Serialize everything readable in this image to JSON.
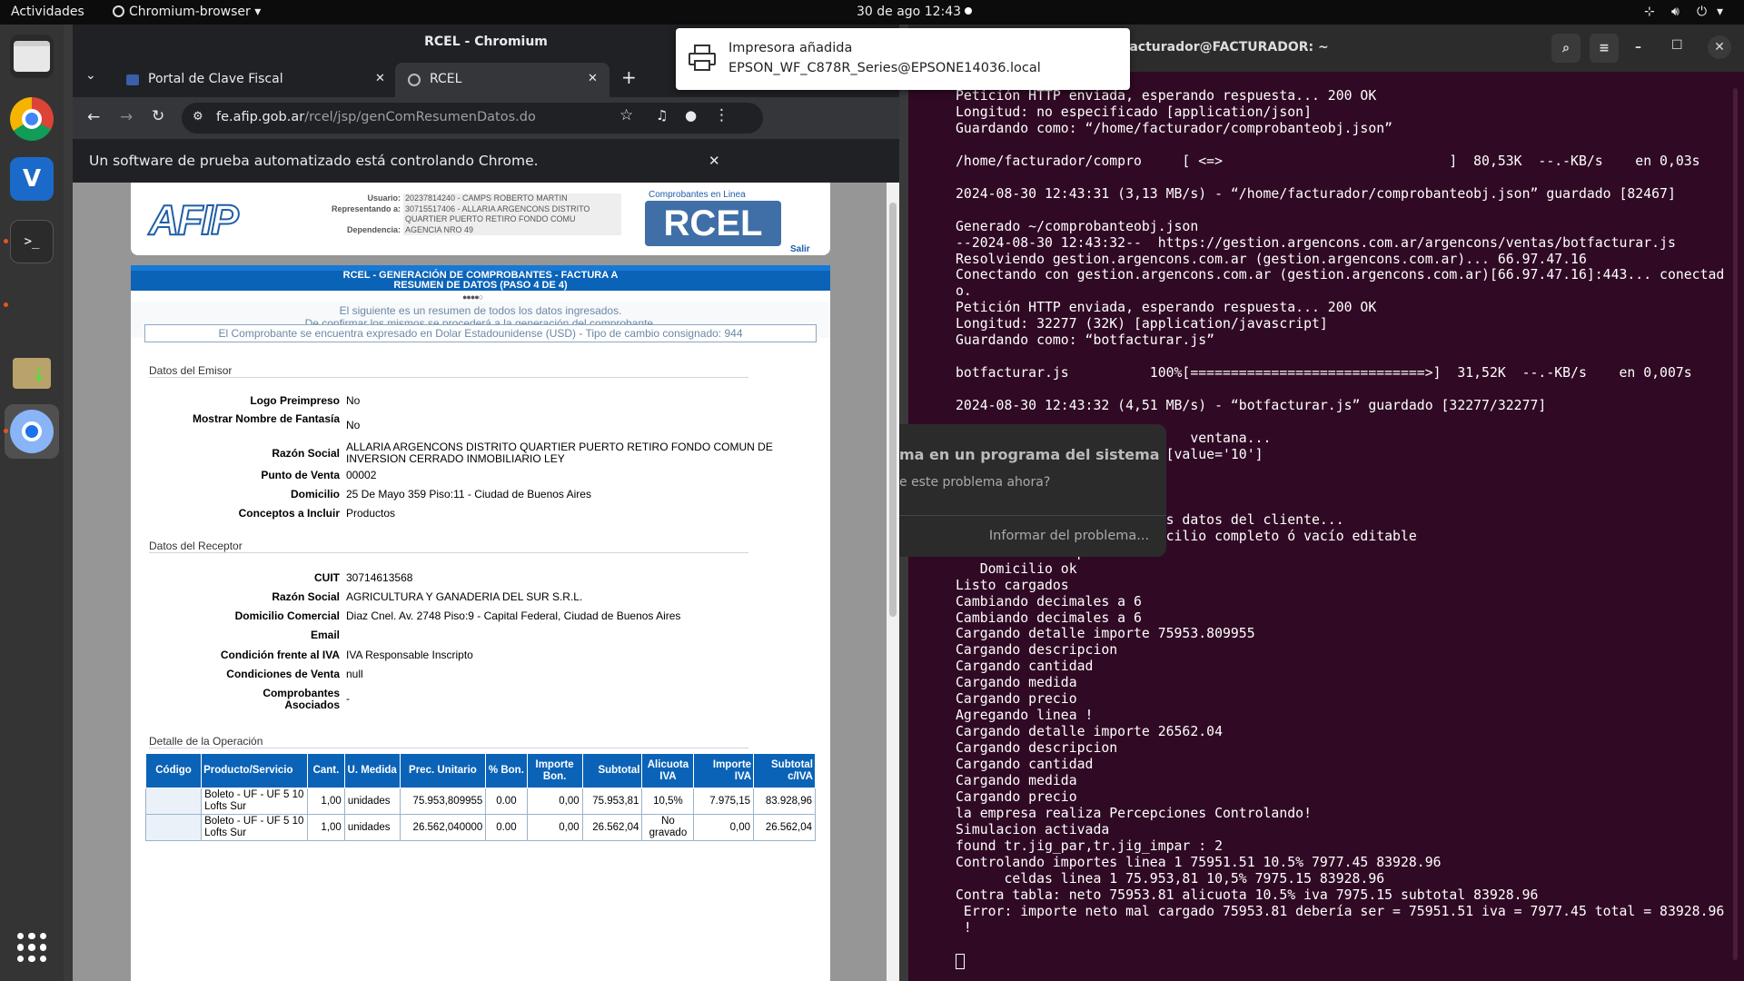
{
  "topbar": {
    "activities": "Actividades",
    "app_menu": "Chromium-browser",
    "clock": "30 de ago  12:43"
  },
  "notification": {
    "title": "Impresora añadida",
    "body": "EPSON_WF_C878R_Series@EPSONE14036.local"
  },
  "chrome": {
    "window_title": "RCEL - Chromium",
    "tabs": [
      {
        "label": "Portal de Clave Fiscal"
      },
      {
        "label": "RCEL"
      }
    ],
    "url_host": "fe.afip.gob.ar",
    "url_path": "/rcel/jsp/genComResumenDatos.do",
    "infobar": "Un software de prueba automatizado está controlando Chrome."
  },
  "afip": {
    "header": {
      "user_label": "Usuario:",
      "user_value": "20237814240 - CAMPS ROBERTO MARTIN",
      "rep_label": "Representando a:",
      "rep_value": "30715517406 - ALLARIA ARGENCONS DISTRITO QUARTIER PUERTO RETIRO FONDO COMU",
      "dep_label": "Dependencia:",
      "dep_value": "AGENCIA NRO 49",
      "rcel_caption": "Comprobantes en Linea",
      "logout": "Salir"
    },
    "banner_line1": "RCEL - GENERACIÓN DE COMPROBANTES - FACTURA A",
    "banner_line2": "RESUMEN DE DATOS (PASO 4 DE 4)",
    "info1": "El siguiente es un resumen de todos los datos ingresados.",
    "info2": "De confirmar los mismos se procederá a la generación del comprobante.",
    "currency_note": "El Comprobante se encuentra expresado en Dolar Estadounidense (USD) - Tipo de cambio consignado: 944",
    "emisor": {
      "title": "Datos del Emisor",
      "rows": [
        {
          "label": "Logo Preimpreso",
          "value": "No"
        },
        {
          "label": "Mostrar Nombre de Fantasía",
          "value": "No"
        },
        {
          "label": "Razón Social",
          "value": "ALLARIA ARGENCONS DISTRITO QUARTIER PUERTO RETIRO FONDO COMUN DE INVERSION CERRADO INMOBILIARIO LEY"
        },
        {
          "label": "Punto de Venta",
          "value": "00002"
        },
        {
          "label": "Domicilio",
          "value": "25 De Mayo 359 Piso:11 - Ciudad de Buenos Aires"
        },
        {
          "label": "Conceptos a Incluir",
          "value": "Productos"
        }
      ]
    },
    "receptor": {
      "title": "Datos del Receptor",
      "rows": [
        {
          "label": "CUIT",
          "value": "30714613568"
        },
        {
          "label": "Razón Social",
          "value": "AGRICULTURA Y GANADERIA DEL SUR S.R.L."
        },
        {
          "label": "Domicilio Comercial",
          "value": "Diaz Cnel. Av. 2748 Piso:9 - Capital Federal, Ciudad de Buenos Aires"
        },
        {
          "label": "Email",
          "value": ""
        },
        {
          "label": "Condición frente al IVA",
          "value": "IVA Responsable Inscripto"
        },
        {
          "label": "Condiciones de Venta",
          "value": "null"
        },
        {
          "label": "Comprobantes Asociados",
          "value": "-"
        }
      ]
    },
    "detalle": {
      "title": "Detalle de la Operación",
      "headers": [
        "Código",
        "Producto/Servicio",
        "Cant.",
        "U. Medida",
        "Prec. Unitario",
        "% Bon.",
        "Importe Bon.",
        "Subtotal",
        "Alicuota IVA",
        "Importe IVA",
        "Subtotal c/IVA"
      ],
      "rows": [
        [
          "",
          "Boleto - UF - UF 5 10 Lofts Sur",
          "1,00",
          "unidades",
          "75.953,809955",
          "0.00",
          "0,00",
          "75.953,81",
          "10,5%",
          "7.975,15",
          "83.928,96"
        ],
        [
          "",
          "Boleto - UF - UF 5 10 Lofts Sur",
          "1,00",
          "unidades",
          "26.562,040000",
          "0.00",
          "0,00",
          "26.562,04",
          "No gravado",
          "0,00",
          "26.562,04"
        ]
      ]
    }
  },
  "error_dialog": {
    "title": "ma en un programa del sistema",
    "question": "e este problema ahora?",
    "action": "Informar del problema..."
  },
  "terminal": {
    "title": "facturador@FACTURADOR: ~",
    "lines": [
      "Petición HTTP enviada, esperando respuesta... 200 OK",
      "Longitud: no especificado [application/json]",
      "Guardando como: “/home/facturador/comprobanteobj.json”",
      "",
      "/home/facturador/compro     [ <=>                            ]  80,53K  --.-KB/s    en 0,03s",
      "",
      "2024-08-30 12:43:31 (3,13 MB/s) - “/home/facturador/comprobanteobj.json” guardado [82467]",
      "",
      "Generado ~/comprobanteobj.json",
      "--2024-08-30 12:43:32--  https://gestion.argencons.com.ar/argencons/ventas/botfacturar.js",
      "Resolviendo gestion.argencons.com.ar (gestion.argencons.com.ar)... 66.97.47.16",
      "Conectando con gestion.argencons.com.ar (gestion.argencons.com.ar)[66.97.47.16]:443... conectad",
      "o.",
      "Petición HTTP enviada, esperando respuesta... 200 OK",
      "Longitud: 32277 (32K) [application/javascript]",
      "Guardando como: “botfacturar.js”",
      "",
      "botfacturar.js          100%[=============================>]  31,52K  --.-KB/s    en 0,007s",
      "",
      "2024-08-30 12:43:32 (4,51 MB/s) - “botfacturar.js” guardado [32277/32277]",
      "",
      "                             ventana...",
      "                          [value='10']",
      "",
      "",
      "",
      "                         os datos del cliente...",
      "Esperando el campo de domicilio completo ó vacío editable",
      "Domicilio con opcion!",
      "   Domicilio ok",
      "Listo cargados",
      "Cambiando decimales a 6",
      "Cambiando decimales a 6",
      "Cargando detalle importe 75953.809955",
      "Cargando descripcion",
      "Cargando cantidad",
      "Cargando medida",
      "Cargando precio",
      "Agregando linea !",
      "Cargando detalle importe 26562.04",
      "Cargando descripcion",
      "Cargando cantidad",
      "Cargando medida",
      "Cargando precio",
      "la empresa realiza Percepciones Controlando!",
      "Simulacion activada",
      "found tr.jig_par,tr.jig_impar : 2",
      "Controlando importes linea 1 75951.51 10.5% 7977.45 83928.96",
      "      celdas linea 1 75.953,81 10,5% 7975.15 83928.96",
      "Contra tabla: neto 75953.81 alicuota 10.5% iva 7975.15 subtotal 83928.96",
      " Error: importe neto mal cargado 75953.81 debería ser = 75951.51 iva = 7977.45 total = 83928.96",
      " !"
    ]
  }
}
